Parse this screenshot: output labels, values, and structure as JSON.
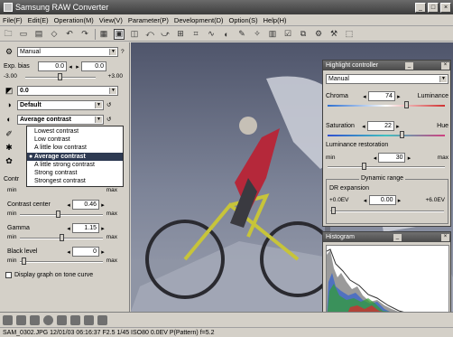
{
  "window": {
    "title": "Samsung RAW Converter"
  },
  "menu": [
    "File(F)",
    "Edit(E)",
    "Operation(M)",
    "View(V)",
    "Parameter(P)",
    "Development(D)",
    "Option(S)",
    "Help(H)"
  ],
  "left": {
    "mode_select": "Manual",
    "exp_bias": {
      "label": "Exp. bias",
      "value1": "0.0",
      "value2": "0.0",
      "min": "-3.00",
      "max": "+3.00"
    },
    "wb_select": "0.0",
    "tone_select": "Default",
    "contrast_select": "Average contrast",
    "contrast_options": [
      "Lowest contrast",
      "Low contrast",
      "A little low contrast",
      "Average contrast",
      "A little strong contrast",
      "Strong contrast",
      "Strongest contrast"
    ],
    "contrast_label": "Contr",
    "min_label": "min",
    "max_label": "max",
    "contrast_center": {
      "label": "Contrast center",
      "value": "0.46"
    },
    "gamma": {
      "label": "Gamma",
      "value": "1.15"
    },
    "black_level": {
      "label": "Black level",
      "value": "0"
    },
    "display_graph": "Display graph on tone curve"
  },
  "highlight": {
    "title": "Highlight controller",
    "mode": "Manual",
    "chroma_label": "Chroma",
    "chroma_value": "74",
    "luminance_label": "Luminance",
    "saturation_label": "Saturation",
    "saturation_value": "22",
    "hue_label": "Hue",
    "lum_restore_label": "Luminance restoration",
    "lum_restore_value": "30",
    "min": "min",
    "max": "max",
    "dr_title": "Dynamic range",
    "dr_expansion": "DR expansion",
    "dr_min": "+0.0EV",
    "dr_value": "0.00",
    "dr_max": "+6.0EV"
  },
  "histogram": {
    "title": "Histogram"
  },
  "status": "SAM_0302.JPG 12/01/03 06:16:37 F2.5 1/45 ISO80 0.0EV P(Pattern) f=5.2"
}
